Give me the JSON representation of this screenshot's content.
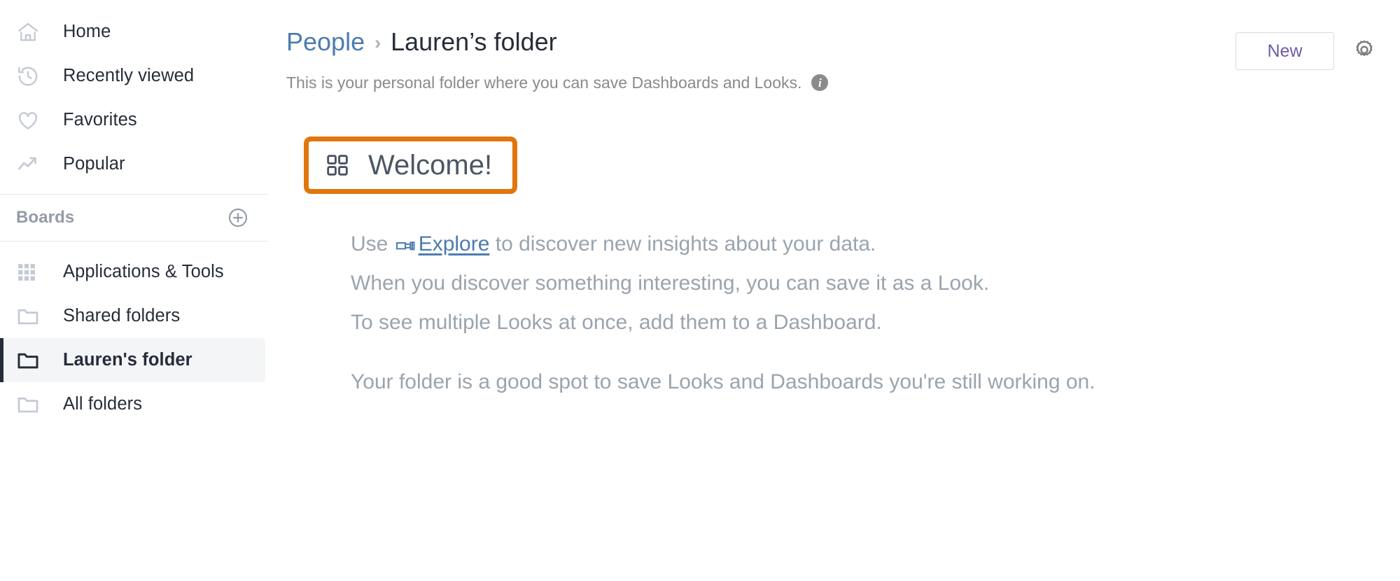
{
  "sidebar": {
    "primary_items": [
      {
        "label": "Home",
        "icon": "home-icon"
      },
      {
        "label": "Recently viewed",
        "icon": "history-clock-icon"
      },
      {
        "label": "Favorites",
        "icon": "heart-icon"
      },
      {
        "label": "Popular",
        "icon": "trending-up-icon"
      }
    ],
    "boards_section": {
      "title": "Boards",
      "add_icon": "plus-circle-icon"
    },
    "folder_items": [
      {
        "label": "Applications & Tools",
        "icon": "grid-dots-icon",
        "selected": false
      },
      {
        "label": "Shared folders",
        "icon": "folder-icon",
        "selected": false
      },
      {
        "label": "Lauren's folder",
        "icon": "folder-icon",
        "selected": true
      },
      {
        "label": "All folders",
        "icon": "folder-icon",
        "selected": false
      }
    ]
  },
  "header": {
    "breadcrumb": {
      "parent": "People",
      "separator": "›",
      "current": "Lauren’s folder"
    },
    "subtitle": "This is your personal folder where you can save Dashboards and Looks.",
    "info_icon": "info-icon",
    "info_glyph": "i",
    "new_button": "New",
    "settings_icon": "gear-icon"
  },
  "content": {
    "welcome": {
      "icon": "dashboard-grid-icon",
      "title": "Welcome!",
      "highlight_color": "#e0760c"
    },
    "lines": {
      "line1_pre": "Use ",
      "line1_link": "Explore",
      "line1_link_icon": "explore-icon",
      "line1_post": " to discover new insights about your data.",
      "line2": "When you discover something interesting, you can save it as a Look.",
      "line3": "To see multiple Looks at once, add them to a Dashboard.",
      "line4": "Your folder is a good spot to save Looks and Dashboards you're still working on."
    }
  },
  "colors": {
    "accent_orange": "#e0760c",
    "link_blue": "#4c7cb0",
    "purple": "#6e5ba6",
    "sidebar_selected_bg": "#f4f5f7",
    "dark_navy": "#262d38",
    "muted_text": "#9aa4ad"
  }
}
